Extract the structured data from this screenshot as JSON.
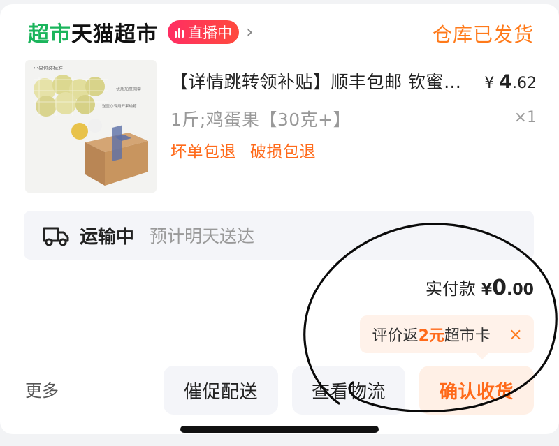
{
  "header": {
    "brand_green": "超市",
    "brand_black": "天猫超市",
    "live_label": "直播中",
    "order_status": "仓库已发货"
  },
  "product": {
    "image_caption_1": "小果包装标准",
    "image_caption_2": "优质加厚网套",
    "image_caption_3": "送至心专用开果纳箱",
    "title": "【详情跳转领补贴】顺丰包邮 钦蜜…",
    "price_symbol": "¥",
    "price_int": "4",
    "price_dec": ".62",
    "spec": "1斤;鸡蛋果【30克+】",
    "quantity": "×1",
    "tags": [
      "坏单包退",
      "破损包退"
    ]
  },
  "shipping": {
    "status": "运输中",
    "eta": "预计明天送达"
  },
  "payment": {
    "label": "实付款",
    "symbol": "¥",
    "int": "0",
    "dec": ".00"
  },
  "promo": {
    "prefix": "评价返",
    "amount": "2元",
    "suffix": "超市卡",
    "close": "×"
  },
  "actions": {
    "more": "更多",
    "urge": "催促配送",
    "logistics": "查看物流",
    "confirm": "确认收货"
  },
  "colors": {
    "brand_green": "#1bb55c",
    "accent_orange": "#ff6a1a",
    "live_red": "#ff2e63"
  }
}
